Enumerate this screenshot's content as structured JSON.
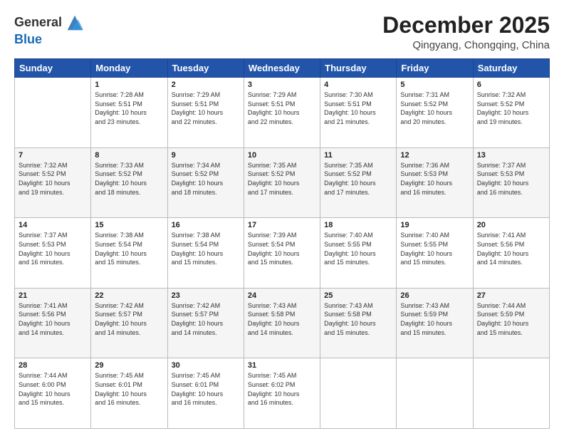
{
  "header": {
    "logo_general": "General",
    "logo_blue": "Blue",
    "month_title": "December 2025",
    "location": "Qingyang, Chongqing, China"
  },
  "days_of_week": [
    "Sunday",
    "Monday",
    "Tuesday",
    "Wednesday",
    "Thursday",
    "Friday",
    "Saturday"
  ],
  "weeks": [
    [
      {
        "day": "",
        "info": ""
      },
      {
        "day": "1",
        "info": "Sunrise: 7:28 AM\nSunset: 5:51 PM\nDaylight: 10 hours\nand 23 minutes."
      },
      {
        "day": "2",
        "info": "Sunrise: 7:29 AM\nSunset: 5:51 PM\nDaylight: 10 hours\nand 22 minutes."
      },
      {
        "day": "3",
        "info": "Sunrise: 7:29 AM\nSunset: 5:51 PM\nDaylight: 10 hours\nand 22 minutes."
      },
      {
        "day": "4",
        "info": "Sunrise: 7:30 AM\nSunset: 5:51 PM\nDaylight: 10 hours\nand 21 minutes."
      },
      {
        "day": "5",
        "info": "Sunrise: 7:31 AM\nSunset: 5:52 PM\nDaylight: 10 hours\nand 20 minutes."
      },
      {
        "day": "6",
        "info": "Sunrise: 7:32 AM\nSunset: 5:52 PM\nDaylight: 10 hours\nand 19 minutes."
      }
    ],
    [
      {
        "day": "7",
        "info": "Sunrise: 7:32 AM\nSunset: 5:52 PM\nDaylight: 10 hours\nand 19 minutes."
      },
      {
        "day": "8",
        "info": "Sunrise: 7:33 AM\nSunset: 5:52 PM\nDaylight: 10 hours\nand 18 minutes."
      },
      {
        "day": "9",
        "info": "Sunrise: 7:34 AM\nSunset: 5:52 PM\nDaylight: 10 hours\nand 18 minutes."
      },
      {
        "day": "10",
        "info": "Sunrise: 7:35 AM\nSunset: 5:52 PM\nDaylight: 10 hours\nand 17 minutes."
      },
      {
        "day": "11",
        "info": "Sunrise: 7:35 AM\nSunset: 5:52 PM\nDaylight: 10 hours\nand 17 minutes."
      },
      {
        "day": "12",
        "info": "Sunrise: 7:36 AM\nSunset: 5:53 PM\nDaylight: 10 hours\nand 16 minutes."
      },
      {
        "day": "13",
        "info": "Sunrise: 7:37 AM\nSunset: 5:53 PM\nDaylight: 10 hours\nand 16 minutes."
      }
    ],
    [
      {
        "day": "14",
        "info": "Sunrise: 7:37 AM\nSunset: 5:53 PM\nDaylight: 10 hours\nand 16 minutes."
      },
      {
        "day": "15",
        "info": "Sunrise: 7:38 AM\nSunset: 5:54 PM\nDaylight: 10 hours\nand 15 minutes."
      },
      {
        "day": "16",
        "info": "Sunrise: 7:38 AM\nSunset: 5:54 PM\nDaylight: 10 hours\nand 15 minutes."
      },
      {
        "day": "17",
        "info": "Sunrise: 7:39 AM\nSunset: 5:54 PM\nDaylight: 10 hours\nand 15 minutes."
      },
      {
        "day": "18",
        "info": "Sunrise: 7:40 AM\nSunset: 5:55 PM\nDaylight: 10 hours\nand 15 minutes."
      },
      {
        "day": "19",
        "info": "Sunrise: 7:40 AM\nSunset: 5:55 PM\nDaylight: 10 hours\nand 15 minutes."
      },
      {
        "day": "20",
        "info": "Sunrise: 7:41 AM\nSunset: 5:56 PM\nDaylight: 10 hours\nand 14 minutes."
      }
    ],
    [
      {
        "day": "21",
        "info": "Sunrise: 7:41 AM\nSunset: 5:56 PM\nDaylight: 10 hours\nand 14 minutes."
      },
      {
        "day": "22",
        "info": "Sunrise: 7:42 AM\nSunset: 5:57 PM\nDaylight: 10 hours\nand 14 minutes."
      },
      {
        "day": "23",
        "info": "Sunrise: 7:42 AM\nSunset: 5:57 PM\nDaylight: 10 hours\nand 14 minutes."
      },
      {
        "day": "24",
        "info": "Sunrise: 7:43 AM\nSunset: 5:58 PM\nDaylight: 10 hours\nand 14 minutes."
      },
      {
        "day": "25",
        "info": "Sunrise: 7:43 AM\nSunset: 5:58 PM\nDaylight: 10 hours\nand 15 minutes."
      },
      {
        "day": "26",
        "info": "Sunrise: 7:43 AM\nSunset: 5:59 PM\nDaylight: 10 hours\nand 15 minutes."
      },
      {
        "day": "27",
        "info": "Sunrise: 7:44 AM\nSunset: 5:59 PM\nDaylight: 10 hours\nand 15 minutes."
      }
    ],
    [
      {
        "day": "28",
        "info": "Sunrise: 7:44 AM\nSunset: 6:00 PM\nDaylight: 10 hours\nand 15 minutes."
      },
      {
        "day": "29",
        "info": "Sunrise: 7:45 AM\nSunset: 6:01 PM\nDaylight: 10 hours\nand 16 minutes."
      },
      {
        "day": "30",
        "info": "Sunrise: 7:45 AM\nSunset: 6:01 PM\nDaylight: 10 hours\nand 16 minutes."
      },
      {
        "day": "31",
        "info": "Sunrise: 7:45 AM\nSunset: 6:02 PM\nDaylight: 10 hours\nand 16 minutes."
      },
      {
        "day": "",
        "info": ""
      },
      {
        "day": "",
        "info": ""
      },
      {
        "day": "",
        "info": ""
      }
    ]
  ]
}
